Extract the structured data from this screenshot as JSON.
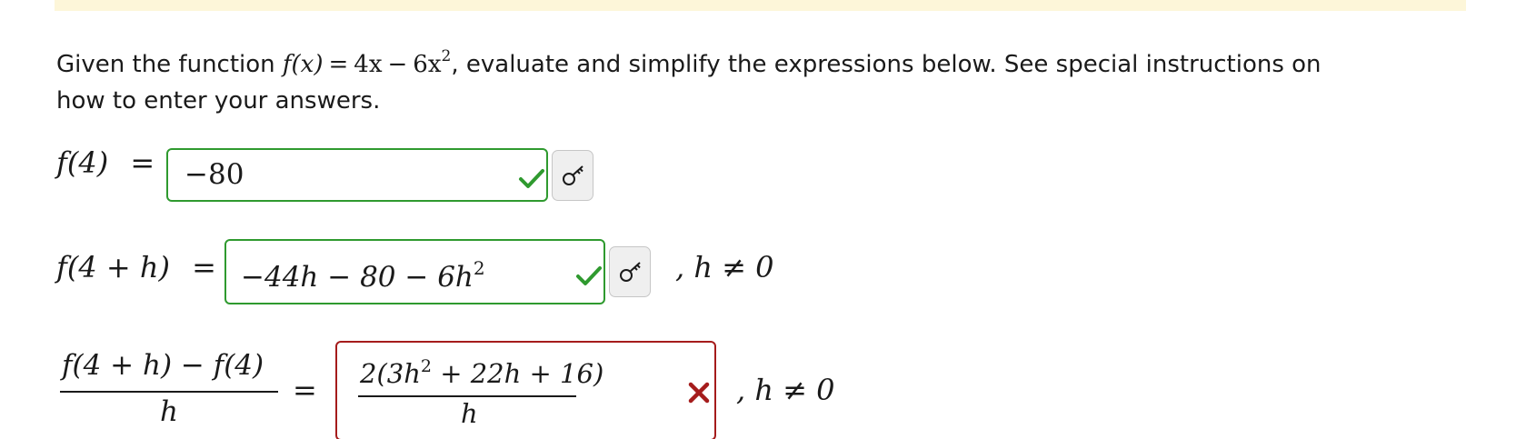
{
  "banner": {
    "color": "#fdf6d9"
  },
  "instructions": {
    "prefix": "Given the function ",
    "function_lhs": "f(x)",
    "equals": "=",
    "function_term1": "4x",
    "minus": "−",
    "function_term2_coef": "6x",
    "function_term2_exp": "2",
    "suffix": ", evaluate and simplify the expressions below. See special instructions on how to enter your answers."
  },
  "questions": [
    {
      "lhs": "f(4)",
      "equals": "=",
      "answer": "−80",
      "status": "correct",
      "status_icon": "check-icon",
      "key_icon": "key-icon",
      "condition": ""
    },
    {
      "lhs": "f(4 + h)",
      "equals": "=",
      "answer_main": "−44h − 80 − 6h",
      "answer_exp": "2",
      "status": "correct",
      "status_icon": "check-icon",
      "key_icon": "key-icon",
      "condition": ", h ≠ 0"
    },
    {
      "lhs_numerator": "f(4 + h) − f(4)",
      "lhs_denominator": "h",
      "equals": "=",
      "answer_numerator_pre": "2(3h",
      "answer_numerator_exp": "2",
      "answer_numerator_post": " + 22h + 16)",
      "answer_denominator": "h",
      "status": "incorrect",
      "status_icon": "x-icon",
      "condition": ", h ≠ 0"
    }
  ],
  "colors": {
    "correct": "#2f9a2f",
    "incorrect": "#a51c1c",
    "text": "#1a1a1a"
  }
}
